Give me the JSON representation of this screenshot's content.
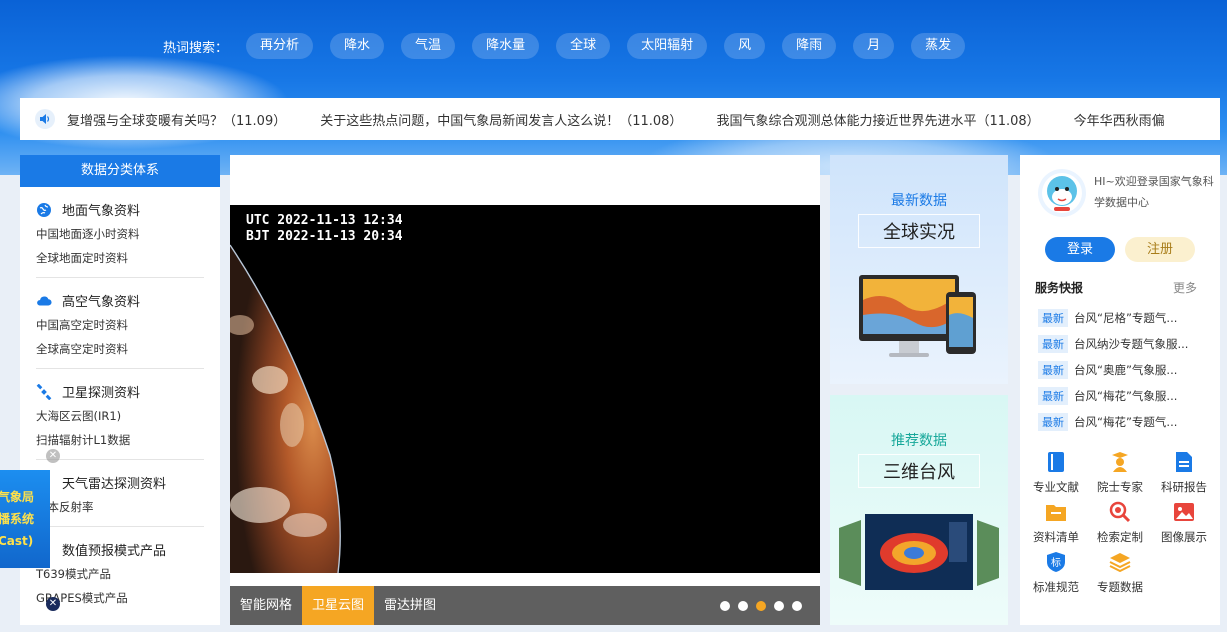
{
  "hot_search": {
    "label": "热词搜索：",
    "tags": [
      "再分析",
      "降水",
      "气温",
      "降水量",
      "全球",
      "太阳辐射",
      "风",
      "降雨",
      "月",
      "蒸发"
    ]
  },
  "news_ticker": {
    "items": [
      "复增强与全球变暖有关吗？（11.09）",
      "关于这些热点问题，中国气象局新闻发言人这么说！（11.08）",
      "我国气象综合观测总体能力接近世界先进水平（11.08）",
      "今年华西秋雨偏"
    ]
  },
  "left_panel": {
    "title": "数据分类体系",
    "categories": [
      {
        "title": "地面气象资料",
        "links": [
          "中国地面逐小时资料",
          "全球地面定时资料"
        ]
      },
      {
        "title": "高空气象资料",
        "links": [
          "中国高空定时资料",
          "全球高空定时资料"
        ]
      },
      {
        "title": "卫星探测资料",
        "links": [
          "大海区云图(IR1)",
          "扫描辐射计L1数据"
        ]
      },
      {
        "title": "天气雷达探测资料",
        "links": [
          "基本反射率"
        ]
      },
      {
        "title": "数值预报模式产品",
        "links": [
          "T639模式产品",
          "GRAPES模式产品"
        ]
      }
    ]
  },
  "float_ad": {
    "lines": [
      "气象局",
      "播系统",
      "Cast)"
    ]
  },
  "slider": {
    "timestamp_utc": "UTC 2022-11-13 12:34",
    "timestamp_bjt": "BJT 2022-11-13 20:34",
    "tabs": [
      "智能网格",
      "卫星云图",
      "雷达拼图"
    ],
    "active_tab": 1,
    "dot_count": 5,
    "active_dot": 2
  },
  "cards": [
    {
      "subtitle": "最新数据",
      "title": "全球实况",
      "subtitle_color": "#1a7ae6"
    },
    {
      "subtitle": "推荐数据",
      "title": "三维台风",
      "subtitle_color": "#17a89a"
    }
  ],
  "user_panel": {
    "welcome": "HI~欢迎登录国家气象科学数据中心",
    "login": "登录",
    "register": "注册",
    "services_title": "服务快报",
    "services_more": "更多",
    "badge": "最新",
    "services": [
      "台风“尼格”专题气...",
      "台风纳沙专题气象服...",
      "台风“奥鹿”气象服...",
      "台风“梅花”气象服...",
      "台风“梅花”专题气..."
    ],
    "quick_links": [
      {
        "label": "专业文献",
        "icon": "book-icon",
        "color": "#1a7ae6"
      },
      {
        "label": "院士专家",
        "icon": "expert-icon",
        "color": "#f5a623"
      },
      {
        "label": "科研报告",
        "icon": "report-icon",
        "color": "#1a7ae6"
      },
      {
        "label": "资料清单",
        "icon": "folder-icon",
        "color": "#f5a623"
      },
      {
        "label": "检索定制",
        "icon": "search-icon",
        "color": "#e8453c"
      },
      {
        "label": "图像展示",
        "icon": "image-icon",
        "color": "#e8453c"
      },
      {
        "label": "标准规范",
        "icon": "standard-icon",
        "color": "#1a7ae6"
      },
      {
        "label": "专题数据",
        "icon": "layers-icon",
        "color": "#f5a623"
      }
    ]
  }
}
